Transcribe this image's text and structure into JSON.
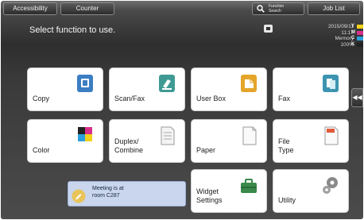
{
  "topbar": {
    "accessibility": "Accessibility",
    "counter": "Counter",
    "search_line1": "Function",
    "search_line2": "Search",
    "job_list": "Job List"
  },
  "status": {
    "title": "Select function to use.",
    "date": "2015/09/11",
    "time": "11:17",
    "memory_label": "Memory",
    "memory_value": "100%"
  },
  "toner": [
    {
      "letter": "Y",
      "color": "#f2d21a"
    },
    {
      "letter": "M",
      "color": "#d8308a"
    },
    {
      "letter": "C",
      "color": "#2aa0dc"
    },
    {
      "letter": "K",
      "color": "#222222"
    }
  ],
  "functions": {
    "copy": "Copy",
    "scan_fax": "Scan/Fax",
    "user_box": "User Box",
    "fax": "Fax",
    "color": "Color",
    "duplex_line1": "Duplex/",
    "duplex_line2": "Combine",
    "paper": "Paper",
    "file_line1": "File",
    "file_line2": "Type",
    "widget_line1": "Widget",
    "widget_line2": "Settings",
    "utility": "Utility"
  },
  "side_tab": "◀◀",
  "message": {
    "line1": "Meeting is at",
    "line2": "room C287"
  },
  "colors": {
    "copy_icon": "#3c7ec2",
    "scan_icon": "#3f9a94",
    "userbox_icon": "#e4a52a",
    "fax_icon": "#3c94b0",
    "widget_icon": "#3a8a4a",
    "message_bg": "#c9d6ee"
  }
}
